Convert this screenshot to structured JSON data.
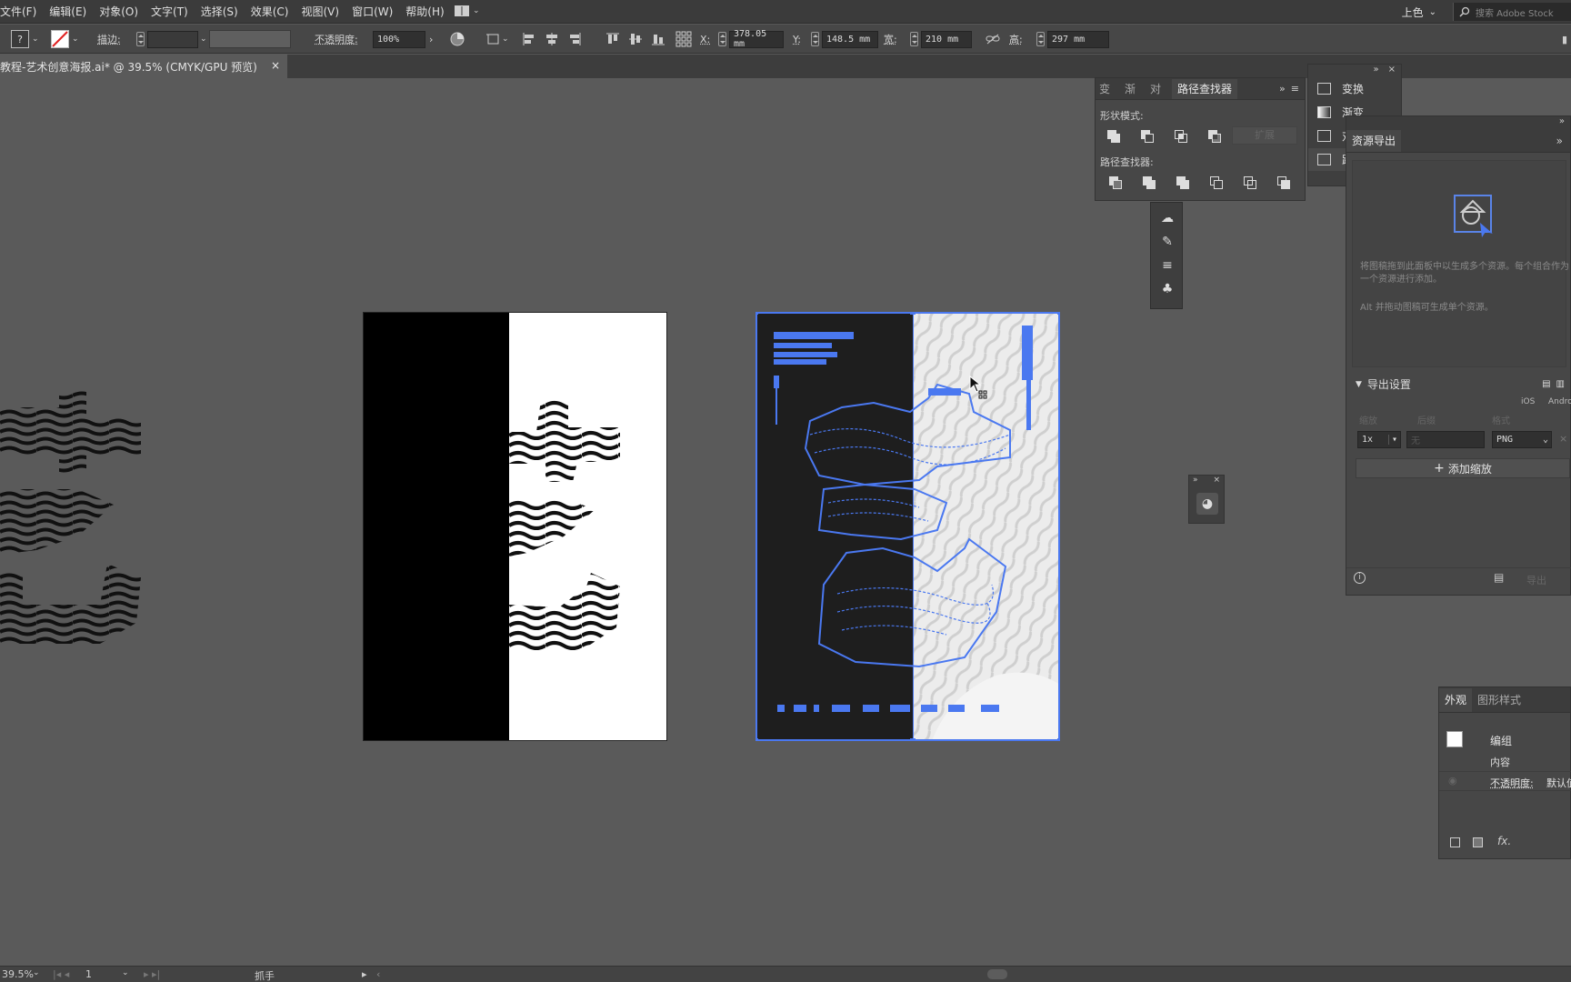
{
  "menu": [
    "文件(F)",
    "编辑(E)",
    "对象(O)",
    "文字(T)",
    "选择(S)",
    "效果(C)",
    "视图(V)",
    "窗口(W)",
    "帮助(H)"
  ],
  "workspace": {
    "name": "上色",
    "search_placeholder": "搜索 Adobe Stock"
  },
  "control": {
    "stroke_label": "描边:",
    "opacity_label": "不透明度:",
    "opacity_value": "100%",
    "x_label": "X:",
    "x_value": "378.05 mm",
    "y_label": "Y:",
    "y_value": "148.5 mm",
    "w_label": "宽:",
    "w_value": "210 mm",
    "h_label": "高:",
    "h_value": "297 mm"
  },
  "document": {
    "tab_title": "教程-艺术创意海报.ai* @ 39.5% (CMYK/GPU 预览)",
    "close": "×"
  },
  "pathfinder": {
    "tabs": [
      "变换",
      "渐变",
      "对齐",
      "路径查找器"
    ],
    "active_tab": "路径查找器",
    "shape_modes_label": "形状模式:",
    "expand_label": "扩展",
    "pathfinders_label": "路径查找器:"
  },
  "mini_panels": [
    {
      "label": "变换",
      "icon": "transform-icon"
    },
    {
      "label": "渐变",
      "icon": "gradient-icon"
    },
    {
      "label": "对",
      "icon": "align-icon"
    },
    {
      "label": "路",
      "icon": "pathfinder-icon"
    }
  ],
  "asset_export": {
    "title": "资源导出",
    "description": "将图稿拖到此面板中以生成多个资源。每个组合作为一个资源进行添加。",
    "hint": "Alt 并拖动图稿可生成单个资源。",
    "export_settings_label": "导出设置",
    "platforms": [
      "iOS",
      "Andro"
    ],
    "col_scale": "缩放",
    "col_suffix": "后缀",
    "col_format": "格式",
    "scale_value": "1x",
    "suffix_placeholder": "无",
    "format_value": "PNG",
    "add_scale_label": "添加缩放",
    "export_button": "导出"
  },
  "appearance": {
    "tabs": [
      "外观",
      "图形样式"
    ],
    "active_tab": "外观",
    "group_label": "编组",
    "contents_label": "内容",
    "opacity_label": "不透明度:",
    "opacity_value": "默认值",
    "fx_label": "fx."
  },
  "status": {
    "zoom": "39.5%",
    "artboard": "1",
    "tool": "抓手"
  },
  "colors": {
    "selection": "#4a78f0",
    "panel_bg": "#474747",
    "canvas_bg": "#5a5a5a"
  }
}
